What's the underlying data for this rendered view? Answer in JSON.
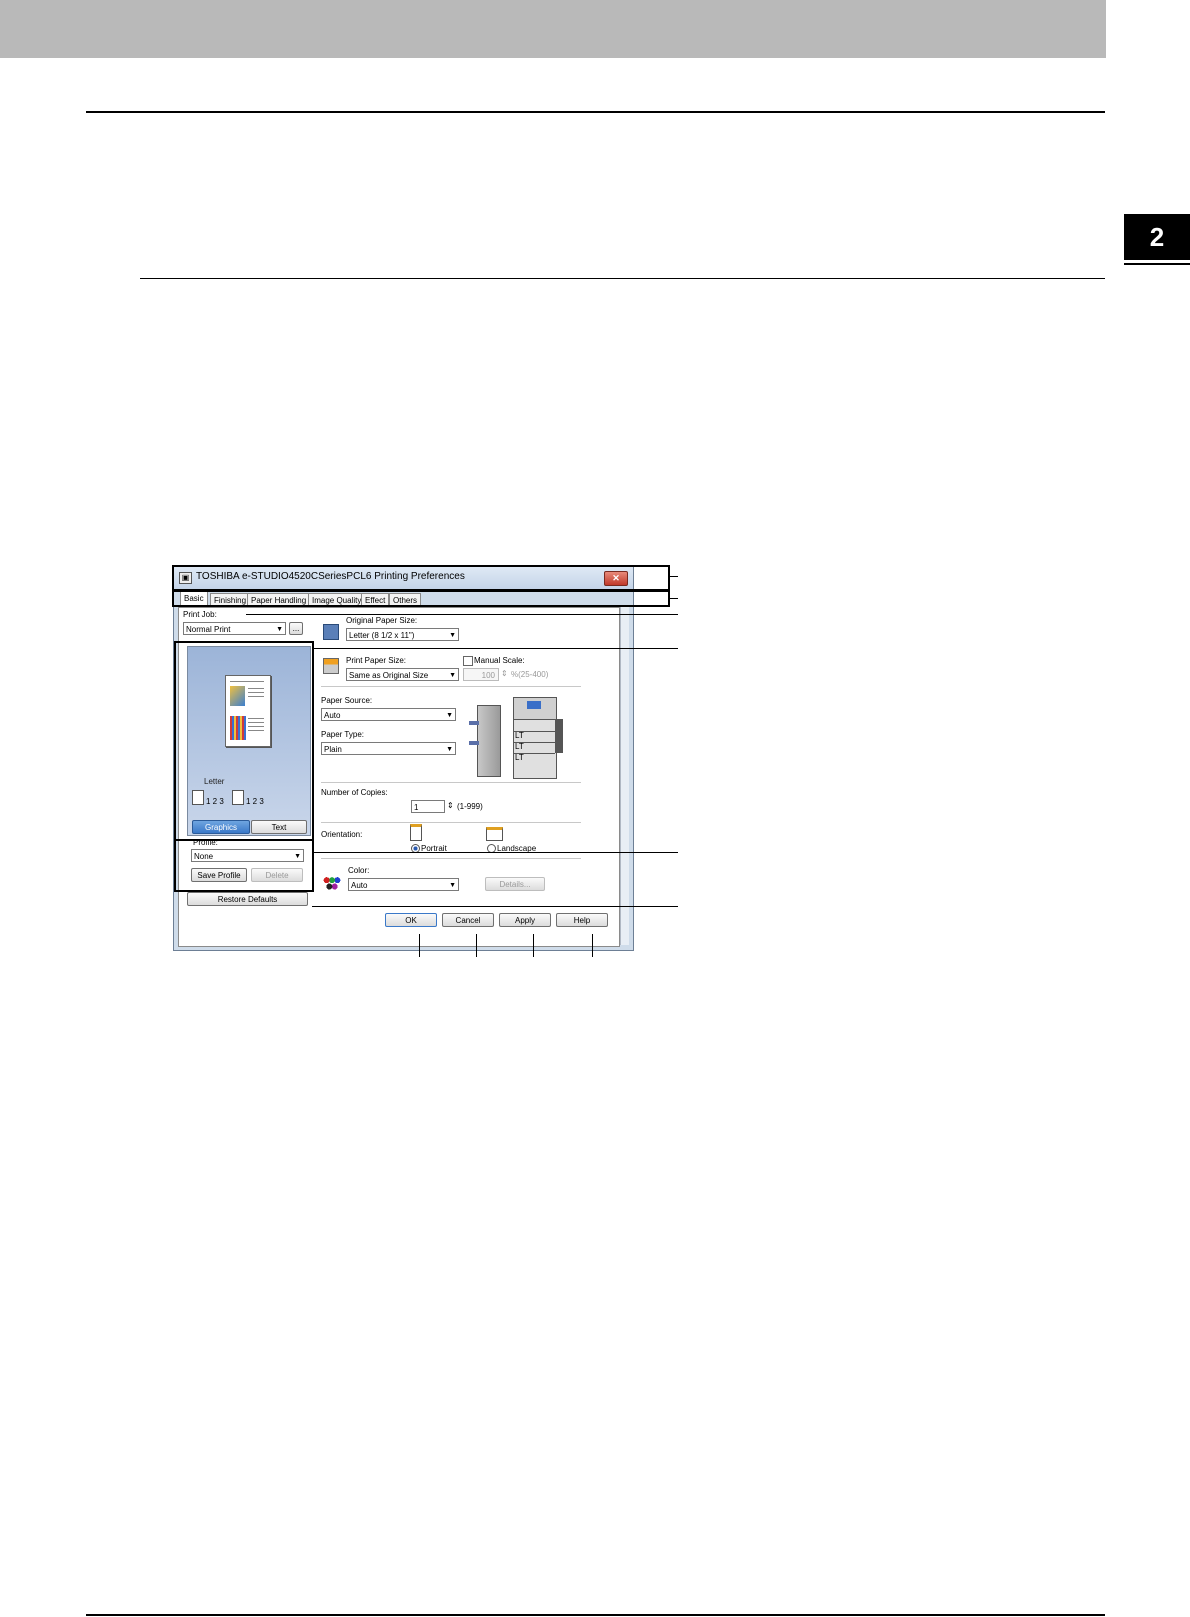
{
  "page": {
    "chapter_number": "2"
  },
  "dialog": {
    "title": "TOSHIBA e-STUDIO4520CSeriesPCL6 Printing Preferences",
    "close_label": "✕",
    "tabs": [
      "Basic",
      "Finishing",
      "Paper Handling",
      "Image Quality",
      "Effect",
      "Others"
    ],
    "active_tab": "Basic",
    "print_job": {
      "label": "Print Job:",
      "value": "Normal Print",
      "more_label": "..."
    },
    "preview": {
      "paper_label": "Letter",
      "copies_label_1": "1 2 3",
      "copies_label_2": "1 2 3",
      "graphics_label": "Graphics",
      "text_label": "Text"
    },
    "profile": {
      "label": "Profile:",
      "value": "None",
      "save_label": "Save Profile",
      "delete_label": "Delete"
    },
    "restore_label": "Restore Defaults",
    "original_paper_size": {
      "label": "Original Paper Size:",
      "value": "Letter (8 1/2 x 11\")"
    },
    "print_paper_size": {
      "label": "Print Paper Size:",
      "value": "Same as Original Size"
    },
    "manual_scale": {
      "label": "Manual Scale:",
      "value": "100",
      "range": "%(25-400)"
    },
    "paper_source": {
      "label": "Paper Source:",
      "value": "Auto"
    },
    "paper_type": {
      "label": "Paper Type:",
      "value": "Plain"
    },
    "printer_tray_labels": [
      "LT",
      "LT",
      "LT"
    ],
    "copies": {
      "label": "Number of Copies:",
      "value": "1",
      "range": "(1-999)"
    },
    "orientation": {
      "label": "Orientation:",
      "portrait": "Portrait",
      "landscape": "Landscape",
      "selected": "portrait"
    },
    "color": {
      "label": "Color:",
      "value": "Auto",
      "details_label": "Details..."
    },
    "buttons": {
      "ok": "OK",
      "cancel": "Cancel",
      "apply": "Apply",
      "help": "Help"
    }
  },
  "colors": {
    "header_band": "#b9b9b9",
    "dialog_frame": "#cfdcea",
    "preview_bg": "#9cb4d8",
    "close_button": "#c0392b"
  }
}
